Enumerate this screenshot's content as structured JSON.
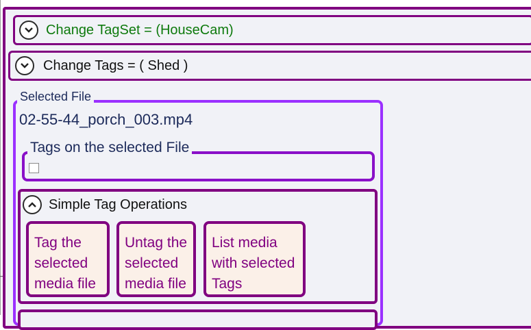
{
  "tagset_expander": {
    "title": "Change TagSet = (HouseCam)",
    "icon": "chevron-down-icon",
    "title_color": "#0e7a0d"
  },
  "tags_expander": {
    "title": "Change Tags = ( Shed )",
    "icon": "chevron-down-icon"
  },
  "selected_file": {
    "legend": "Selected File",
    "file_name": "02-55-44_porch_003.mp4",
    "tags_legend": "Tags on the selected File",
    "tag_checked": false
  },
  "simple_ops": {
    "title": "Simple Tag Operations",
    "icon": "chevron-up-icon",
    "buttons": [
      {
        "label": "Tag the\nselected\nmedia file"
      },
      {
        "label": "Untag the\nselected\nmedia file"
      },
      {
        "label": "List media\nwith selected\nTags"
      }
    ]
  },
  "colors": {
    "accent": "#800080",
    "file_border": "#9b30ff",
    "button_bg": "#fbf0e8"
  }
}
